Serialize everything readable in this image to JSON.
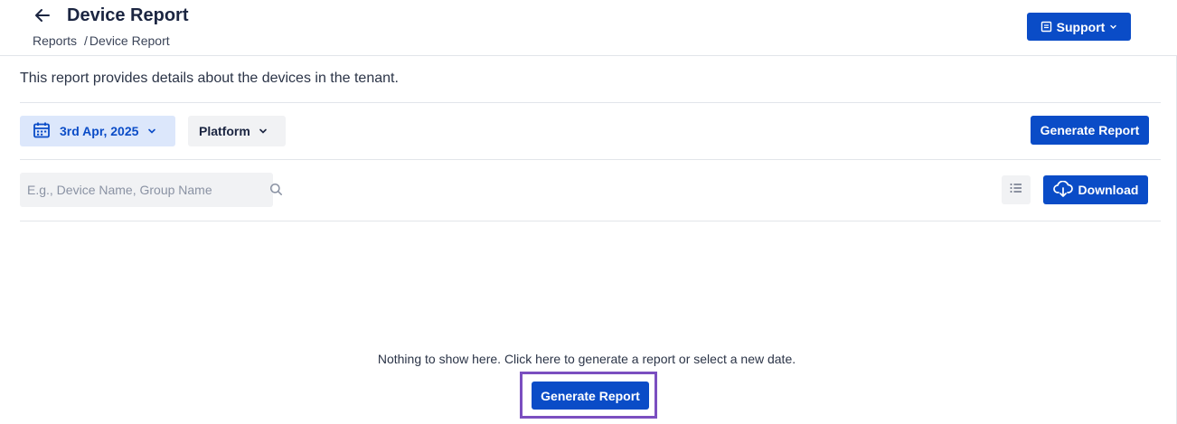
{
  "header": {
    "title": "Device Report",
    "breadcrumb": {
      "parent": "Reports",
      "separator": "/",
      "current": "Device Report"
    },
    "support_label": "Support"
  },
  "description": "This report provides details about the devices in the tenant.",
  "filters": {
    "date_label": "3rd Apr, 2025",
    "platform_label": "Platform",
    "generate_label": "Generate Report"
  },
  "toolbar": {
    "search_placeholder": "E.g., Device Name, Group Name",
    "download_label": "Download"
  },
  "empty_state": {
    "message": "Nothing to show here. Click here to generate a report or select a new date.",
    "generate_label": "Generate Report"
  },
  "colors": {
    "primary": "#0a4cc7",
    "highlight": "#7b4fc0",
    "date_bg": "#dce7fb"
  },
  "icons": [
    "arrow-left-icon",
    "document-icon",
    "chevron-down-icon",
    "calendar-icon",
    "search-icon",
    "list-icon",
    "cloud-download-icon"
  ]
}
